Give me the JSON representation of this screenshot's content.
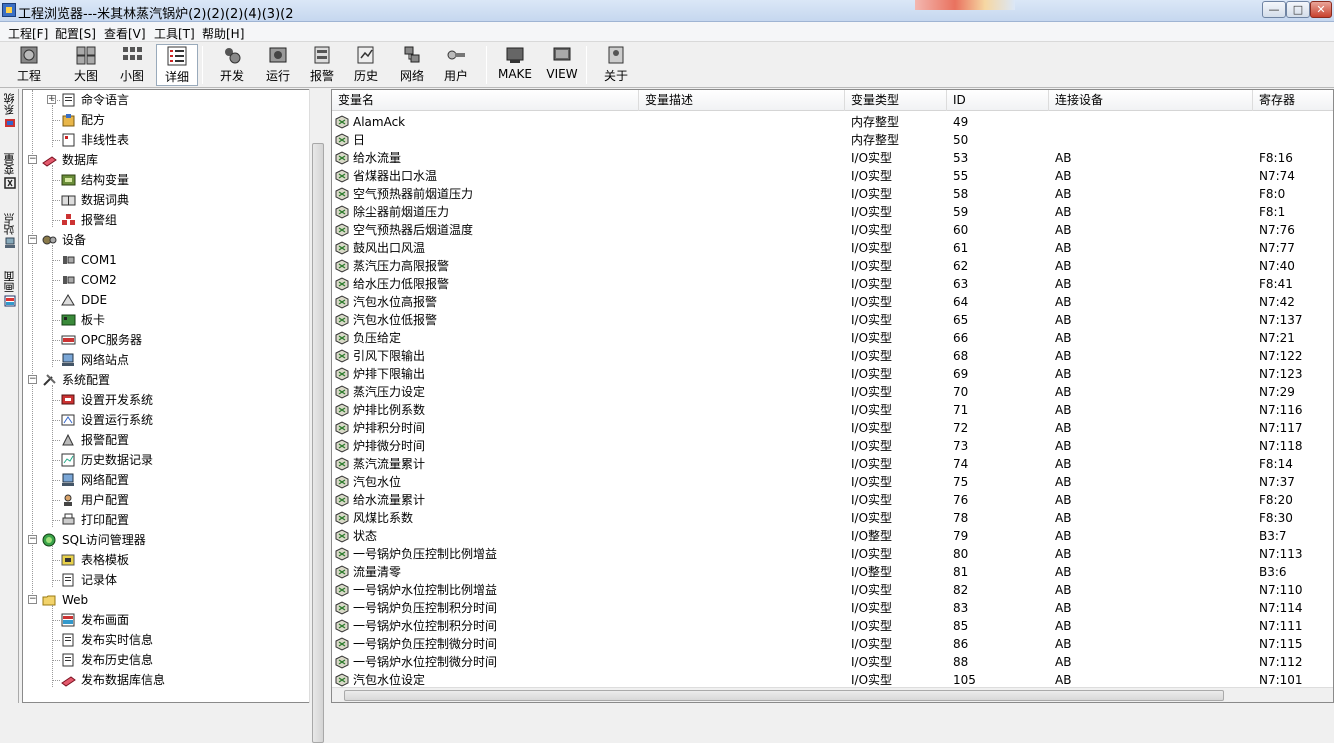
{
  "window": {
    "title": "工程浏览器---米其林蒸汽锅炉(2)(2)(2)(4)(3)(2",
    "min_icon": "minimize-icon",
    "max_icon": "maximize-icon",
    "close_icon": "close-icon",
    "min_glyph": "—",
    "max_glyph": "□",
    "close_glyph": "✕"
  },
  "menu": [
    "工程[F]",
    "配置[S]",
    "查看[V]",
    "工具[T]",
    "帮助[H]"
  ],
  "toolbar": [
    {
      "label": "工程",
      "icon": "project-icon"
    },
    {
      "label": "大图",
      "icon": "large-icons-icon"
    },
    {
      "label": "小图",
      "icon": "small-icons-icon"
    },
    {
      "label": "详细",
      "icon": "details-icon",
      "active": true
    },
    {
      "label": "开发",
      "icon": "develop-icon"
    },
    {
      "label": "运行",
      "icon": "run-icon"
    },
    {
      "label": "报警",
      "icon": "alarm-icon"
    },
    {
      "label": "历史",
      "icon": "history-icon"
    },
    {
      "label": "网络",
      "icon": "network-icon"
    },
    {
      "label": "用户",
      "icon": "user-icon"
    },
    {
      "label": "MAKE",
      "icon": "make-icon"
    },
    {
      "label": "VIEW",
      "icon": "view-icon"
    },
    {
      "label": "关于",
      "icon": "about-icon"
    }
  ],
  "side_tabs": [
    "系统",
    "变量",
    "站点",
    "画面"
  ],
  "tree": [
    {
      "label": "命令语言",
      "icon": "command-language-icon",
      "level": 2,
      "expander": "+"
    },
    {
      "label": "配方",
      "icon": "recipe-icon",
      "level": 2
    },
    {
      "label": "非线性表",
      "icon": "nonlinear-table-icon",
      "level": 2
    },
    {
      "label": "数据库",
      "icon": "database-icon",
      "level": 1,
      "expander": "−"
    },
    {
      "label": "结构变量",
      "icon": "struct-variable-icon",
      "level": 2
    },
    {
      "label": "数据词典",
      "icon": "data-dictionary-icon",
      "level": 2
    },
    {
      "label": "报警组",
      "icon": "alarm-group-icon",
      "level": 2
    },
    {
      "label": "设备",
      "icon": "device-icon",
      "level": 1,
      "expander": "−"
    },
    {
      "label": "COM1",
      "icon": "serial-port-icon",
      "level": 2
    },
    {
      "label": "COM2",
      "icon": "serial-port-icon",
      "level": 2
    },
    {
      "label": "DDE",
      "icon": "dde-icon",
      "level": 2
    },
    {
      "label": "板卡",
      "icon": "board-card-icon",
      "level": 2
    },
    {
      "label": "OPC服务器",
      "icon": "opc-server-icon",
      "level": 2
    },
    {
      "label": "网络站点",
      "icon": "network-station-icon",
      "level": 2
    },
    {
      "label": "系统配置",
      "icon": "system-config-icon",
      "level": 1,
      "expander": "−"
    },
    {
      "label": "设置开发系统",
      "icon": "dev-system-icon",
      "level": 2
    },
    {
      "label": "设置运行系统",
      "icon": "run-system-icon",
      "level": 2
    },
    {
      "label": "报警配置",
      "icon": "alarm-config-icon",
      "level": 2
    },
    {
      "label": "历史数据记录",
      "icon": "history-record-icon",
      "level": 2
    },
    {
      "label": "网络配置",
      "icon": "network-config-icon",
      "level": 2
    },
    {
      "label": "用户配置",
      "icon": "user-config-icon",
      "level": 2
    },
    {
      "label": "打印配置",
      "icon": "print-config-icon",
      "level": 2
    },
    {
      "label": "SQL访问管理器",
      "icon": "sql-manager-icon",
      "level": 1,
      "expander": "−"
    },
    {
      "label": "表格模板",
      "icon": "table-template-icon",
      "level": 2
    },
    {
      "label": "记录体",
      "icon": "record-icon",
      "level": 2
    },
    {
      "label": "Web",
      "icon": "folder-icon",
      "level": 1,
      "expander": "−"
    },
    {
      "label": "发布画面",
      "icon": "publish-screen-icon",
      "level": 2
    },
    {
      "label": "发布实时信息",
      "icon": "publish-realtime-icon",
      "level": 2
    },
    {
      "label": "发布历史信息",
      "icon": "publish-history-icon",
      "level": 2
    },
    {
      "label": "发布数据库信息",
      "icon": "publish-database-icon",
      "level": 2
    }
  ],
  "columns": [
    "变量名",
    "变量描述",
    "变量类型",
    "ID",
    "连接设备",
    "寄存器"
  ],
  "rows": [
    [
      "AlamAck",
      "",
      "内存整型",
      "49",
      "",
      ""
    ],
    [
      "日",
      "",
      "内存整型",
      "50",
      "",
      ""
    ],
    [
      "给水流量",
      "",
      "I/O实型",
      "53",
      "AB",
      "F8:16"
    ],
    [
      "省煤器出口水温",
      "",
      "I/O实型",
      "55",
      "AB",
      "N7:74"
    ],
    [
      "空气预热器前烟道压力",
      "",
      "I/O实型",
      "58",
      "AB",
      "F8:0"
    ],
    [
      "除尘器前烟道压力",
      "",
      "I/O实型",
      "59",
      "AB",
      "F8:1"
    ],
    [
      "空气预热器后烟道温度",
      "",
      "I/O实型",
      "60",
      "AB",
      "N7:76"
    ],
    [
      "鼓风出口风温",
      "",
      "I/O实型",
      "61",
      "AB",
      "N7:77"
    ],
    [
      "蒸汽压力高限报警",
      "",
      "I/O实型",
      "62",
      "AB",
      "N7:40"
    ],
    [
      "给水压力低限报警",
      "",
      "I/O实型",
      "63",
      "AB",
      "F8:41"
    ],
    [
      "汽包水位高报警",
      "",
      "I/O实型",
      "64",
      "AB",
      "N7:42"
    ],
    [
      "汽包水位低报警",
      "",
      "I/O实型",
      "65",
      "AB",
      "N7:137"
    ],
    [
      "负压给定",
      "",
      "I/O实型",
      "66",
      "AB",
      "N7:21"
    ],
    [
      "引风下限输出",
      "",
      "I/O实型",
      "68",
      "AB",
      "N7:122"
    ],
    [
      "炉排下限输出",
      "",
      "I/O实型",
      "69",
      "AB",
      "N7:123"
    ],
    [
      "蒸汽压力设定",
      "",
      "I/O实型",
      "70",
      "AB",
      "N7:29"
    ],
    [
      "炉排比例系数",
      "",
      "I/O实型",
      "71",
      "AB",
      "N7:116"
    ],
    [
      "炉排积分时间",
      "",
      "I/O实型",
      "72",
      "AB",
      "N7:117"
    ],
    [
      "炉排微分时间",
      "",
      "I/O实型",
      "73",
      "AB",
      "N7:118"
    ],
    [
      "蒸汽流量累计",
      "",
      "I/O实型",
      "74",
      "AB",
      "F8:14"
    ],
    [
      "汽包水位",
      "",
      "I/O实型",
      "75",
      "AB",
      "N7:37"
    ],
    [
      "给水流量累计",
      "",
      "I/O实型",
      "76",
      "AB",
      "F8:20"
    ],
    [
      "风煤比系数",
      "",
      "I/O实型",
      "78",
      "AB",
      "F8:30"
    ],
    [
      "状态",
      "",
      "I/O整型",
      "79",
      "AB",
      "B3:7"
    ],
    [
      "一号锅炉负压控制比例增益",
      "",
      "I/O实型",
      "80",
      "AB",
      "N7:113"
    ],
    [
      "流量清零",
      "",
      "I/O整型",
      "81",
      "AB",
      "B3:6"
    ],
    [
      "一号锅炉水位控制比例增益",
      "",
      "I/O实型",
      "82",
      "AB",
      "N7:110"
    ],
    [
      "一号锅炉负压控制积分时间",
      "",
      "I/O实型",
      "83",
      "AB",
      "N7:114"
    ],
    [
      "一号锅炉水位控制积分时间",
      "",
      "I/O实型",
      "85",
      "AB",
      "N7:111"
    ],
    [
      "一号锅炉负压控制微分时间",
      "",
      "I/O实型",
      "86",
      "AB",
      "N7:115"
    ],
    [
      "一号锅炉水位控制微分时间",
      "",
      "I/O实型",
      "88",
      "AB",
      "N7:112"
    ],
    [
      "汽包水位设定",
      "",
      "I/O实型",
      "105",
      "AB",
      "N7:101"
    ]
  ]
}
